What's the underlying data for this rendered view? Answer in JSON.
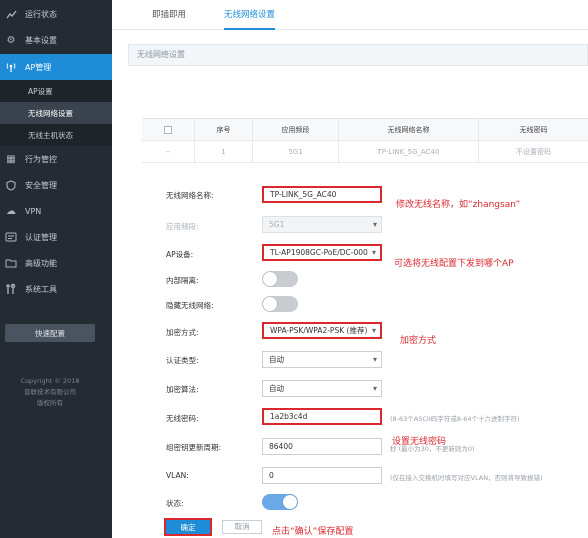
{
  "sidebar": {
    "items": [
      {
        "label": "运行状态",
        "icon": "chart-icon"
      },
      {
        "label": "基本设置",
        "icon": "gear-icon"
      },
      {
        "label": "AP管理",
        "icon": "antenna-icon"
      },
      {
        "label": "行为管控",
        "icon": "grid-icon"
      },
      {
        "label": "安全管理",
        "icon": "shield-icon"
      },
      {
        "label": "VPN",
        "icon": "cloud-icon"
      },
      {
        "label": "认证管理",
        "icon": "id-card-icon"
      },
      {
        "label": "高级功能",
        "icon": "folder-icon"
      },
      {
        "label": "系统工具",
        "icon": "tools-icon"
      }
    ],
    "sub_items": [
      {
        "label": "AP设置"
      },
      {
        "label": "无线网络设置"
      },
      {
        "label": "无线主机状态"
      }
    ],
    "quick_config": "快速配置",
    "copyright_lines": [
      "Copyright © 2018",
      "普联技术有限公司",
      "版权所有"
    ]
  },
  "tabs": [
    {
      "label": "即插即用"
    },
    {
      "label": "无线网络设置"
    }
  ],
  "panel_title": "无线网络设置",
  "table": {
    "headers": [
      "",
      "序号",
      "应用频段",
      "无线网络名称",
      "无线密码"
    ],
    "row": [
      "--",
      "1",
      "5G1",
      "TP-LINK_5G_AC40",
      "不设置密码"
    ]
  },
  "form": {
    "ssid": {
      "label": "无线网络名称:",
      "value": "TP-LINK_5G_AC40"
    },
    "band": {
      "label": "应用频段:",
      "value": "5G1"
    },
    "ap_device": {
      "label": "AP设备:",
      "value": "TL-AP1908GC-PoE/DC-000"
    },
    "isolation": {
      "label": "内部隔离:"
    },
    "hide_ssid": {
      "label": "隐藏无线网络:"
    },
    "encryption": {
      "label": "加密方式:",
      "value": "WPA-PSK/WPA2-PSK (推荐)"
    },
    "auth_type": {
      "label": "认证类型:",
      "value": "自动"
    },
    "algorithm": {
      "label": "加密算法:",
      "value": "自动"
    },
    "password": {
      "label": "无线密码:",
      "value": "1a2b3c4d",
      "hint": "(8-63个ASCII码字符或8-64个十六进制字符)"
    },
    "group_key": {
      "label": "组密钥更新周期:",
      "value": "86400",
      "hint": "秒 (最小为30，不更新则为0)"
    },
    "vlan": {
      "label": "VLAN:",
      "value": "0",
      "hint": "(仅在接入交换机时填写对应VLAN，否则将导致报错)"
    },
    "status": {
      "label": "状态:"
    }
  },
  "buttons": {
    "ok": "确定",
    "cancel": "取消"
  },
  "annotations": {
    "ssid": "修改无线名称，如“zhangsan”",
    "ap": "可选将无线配置下发到哪个AP",
    "encryption": "加密方式",
    "password": "设置无线密码",
    "confirm": "点击“确认”保存配置"
  },
  "colors": {
    "accent": "#1e8cd6",
    "sidebar": "#252b33",
    "annotation": "#d9292f"
  }
}
